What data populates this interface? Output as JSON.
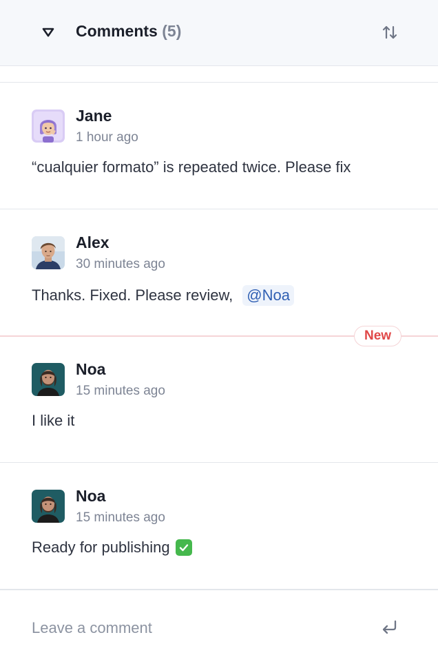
{
  "header": {
    "title": "Comments",
    "count": "(5)",
    "toggle_icon": "triangle-down-icon",
    "sort_icon": "sort-arrows-icon"
  },
  "comments": [
    {
      "author": "Jane",
      "time": "1 hour ago",
      "text": "“cualquier formato” is repeated twice. Please fix",
      "avatar": "memoji-avatar"
    },
    {
      "author": "Alex",
      "time": "30 minutes ago",
      "text": "Thanks. Fixed. Please review,",
      "mention": "@Noa",
      "avatar": "photo-avatar"
    },
    {
      "author": "Noa",
      "time": "15 minutes ago",
      "text": "I like it",
      "avatar": "photo-avatar"
    },
    {
      "author": "Noa",
      "time": "15 minutes ago",
      "text": "Ready for publishing",
      "emoji": "white-check-mark",
      "avatar": "photo-avatar"
    }
  ],
  "new_marker": {
    "label": "New",
    "color": "#e04848"
  },
  "composer": {
    "placeholder": "Leave a comment",
    "send_icon": "enter-return-icon"
  },
  "colors": {
    "header_bg": "#f6f8fb",
    "mention_bg": "#eef3fb",
    "mention_text": "#2f5fb3",
    "muted_text": "#7d8494"
  }
}
